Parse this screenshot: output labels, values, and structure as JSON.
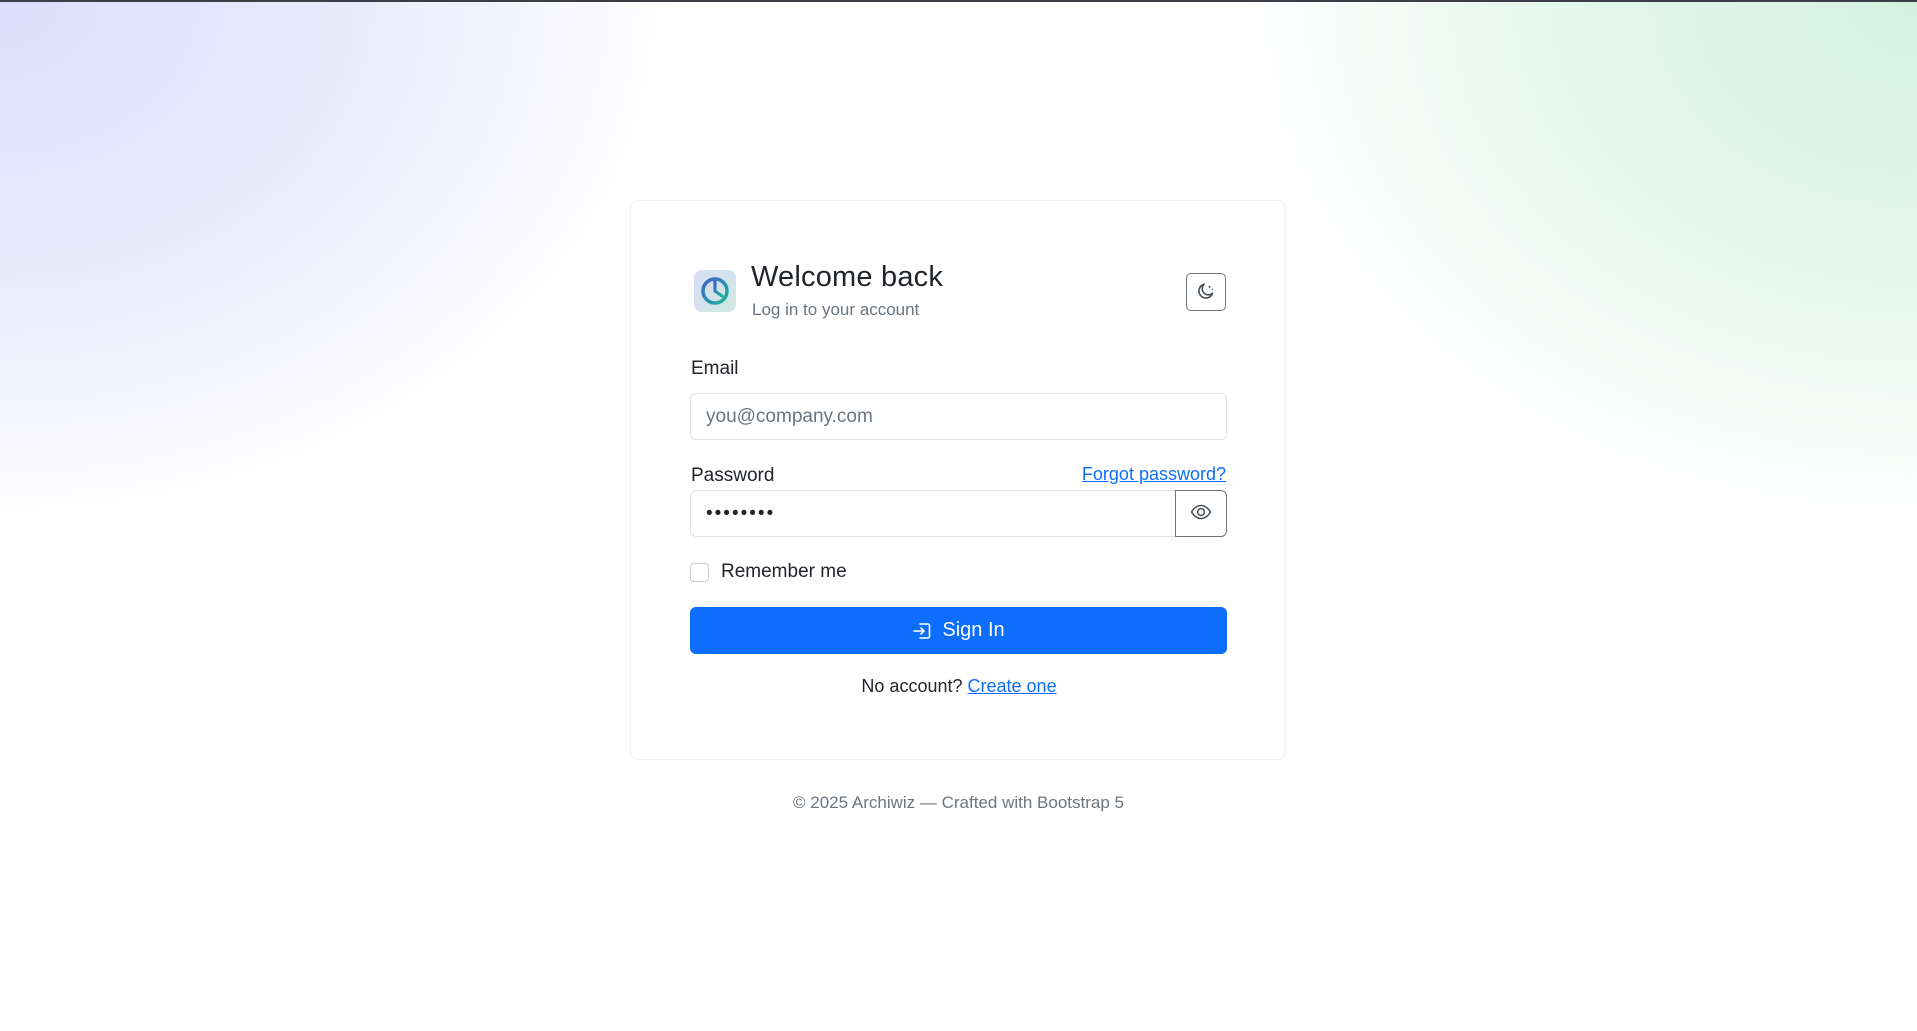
{
  "header": {
    "title": "Welcome back",
    "subtitle": "Log in to your account",
    "logo_icon": "clock-logo-icon",
    "theme_toggle_icon": "moon-stars-icon"
  },
  "form": {
    "email_label": "Email",
    "email_placeholder": "you@company.com",
    "email_value": "",
    "password_label": "Password",
    "password_value": "••••••••",
    "forgot_label": "Forgot password?",
    "show_password_icon": "eye-icon",
    "remember_label": "Remember me",
    "remember_checked": false,
    "submit_label": "Sign In",
    "submit_icon": "box-arrow-in-right-icon",
    "no_account_text": "No account?",
    "create_label": "Create one"
  },
  "footer": {
    "text": "© 2025 Archiwiz — Crafted with Bootstrap 5"
  },
  "colors": {
    "primary": "#0d6efd",
    "muted": "#6c757d",
    "background_left": "#ddddfc",
    "background_right": "#d4f1e2"
  }
}
